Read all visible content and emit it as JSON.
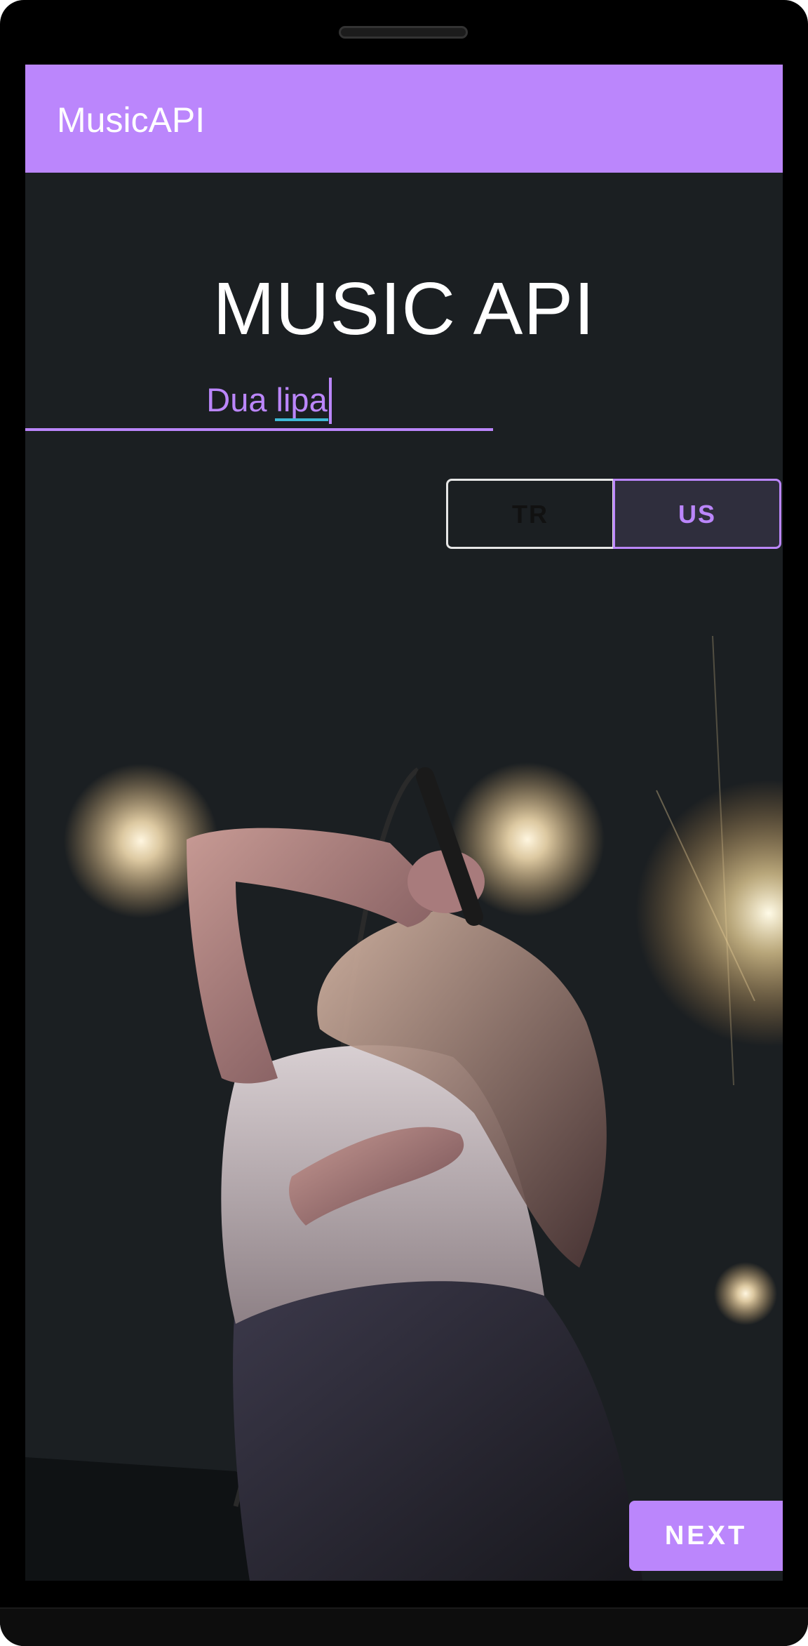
{
  "app_bar": {
    "title": "MusicAPI"
  },
  "main": {
    "heading": "MUSIC API",
    "search": {
      "value": "Dua lipa",
      "placeholder": ""
    },
    "country_toggle": {
      "options": [
        "TR",
        "US"
      ],
      "selected": "US"
    },
    "next_button_label": "NEXT"
  },
  "colors": {
    "accent": "#bb86fc",
    "background": "#1b1f22",
    "text_primary": "#ffffff"
  },
  "icons": []
}
